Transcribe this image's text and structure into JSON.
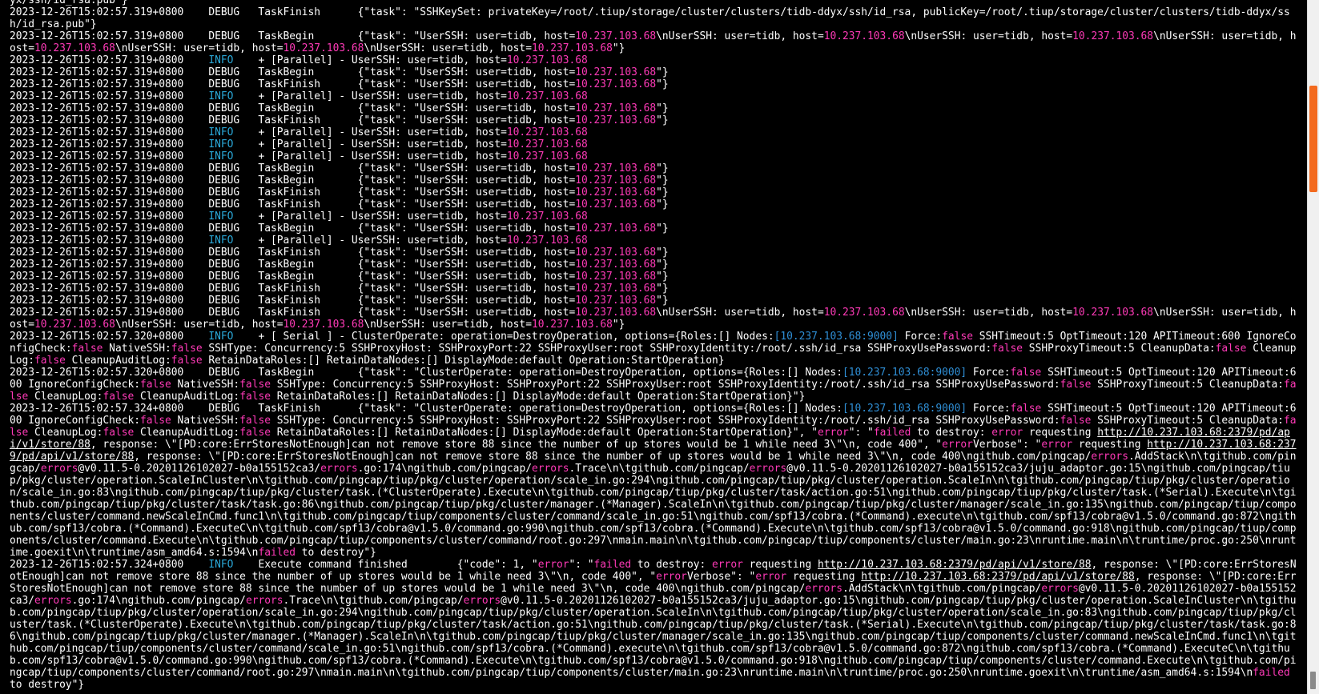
{
  "terminal": {
    "lines": [
      "yx/ssh/id_rsa.pub\"}",
      "2023-12-26T15:02:57.319+0800    DEBUG   TaskFinish      {\"task\": \"SSHKeySet: privateKey=/root/.tiup/storage/cluster/clusters/tidb-ddyx/ssh/id_rsa, publicKey=/root/.tiup/storage/cluster/clusters/tidb-ddyx/ssh/id_rsa.pub\"}",
      "2023-12-26T15:02:57.319+0800    DEBUG   TaskBegin       {\"task\": \"UserSSH: user=tidb, host=10.237.103.68\\nUserSSH: user=tidb, host=10.237.103.68\\nUserSSH: user=tidb, host=10.237.103.68\\nUserSSH: user=tidb, host=10.237.103.68\\nUserSSH: user=tidb, host=10.237.103.68\\nUserSSH: user=tidb, host=10.237.103.68\"}",
      "2023-12-26T15:02:57.319+0800    INFO    + [Parallel] - UserSSH: user=tidb, host=10.237.103.68",
      "2023-12-26T15:02:57.319+0800    DEBUG   TaskBegin       {\"task\": \"UserSSH: user=tidb, host=10.237.103.68\"}",
      "2023-12-26T15:02:57.319+0800    DEBUG   TaskFinish      {\"task\": \"UserSSH: user=tidb, host=10.237.103.68\"}",
      "2023-12-26T15:02:57.319+0800    INFO    + [Parallel] - UserSSH: user=tidb, host=10.237.103.68",
      "2023-12-26T15:02:57.319+0800    DEBUG   TaskBegin       {\"task\": \"UserSSH: user=tidb, host=10.237.103.68\"}",
      "2023-12-26T15:02:57.319+0800    DEBUG   TaskFinish      {\"task\": \"UserSSH: user=tidb, host=10.237.103.68\"}",
      "2023-12-26T15:02:57.319+0800    INFO    + [Parallel] - UserSSH: user=tidb, host=10.237.103.68",
      "2023-12-26T15:02:57.319+0800    INFO    + [Parallel] - UserSSH: user=tidb, host=10.237.103.68",
      "2023-12-26T15:02:57.319+0800    INFO    + [Parallel] - UserSSH: user=tidb, host=10.237.103.68",
      "2023-12-26T15:02:57.319+0800    DEBUG   TaskBegin       {\"task\": \"UserSSH: user=tidb, host=10.237.103.68\"}",
      "2023-12-26T15:02:57.319+0800    DEBUG   TaskBegin       {\"task\": \"UserSSH: user=tidb, host=10.237.103.68\"}",
      "2023-12-26T15:02:57.319+0800    DEBUG   TaskFinish      {\"task\": \"UserSSH: user=tidb, host=10.237.103.68\"}",
      "2023-12-26T15:02:57.319+0800    DEBUG   TaskFinish      {\"task\": \"UserSSH: user=tidb, host=10.237.103.68\"}",
      "2023-12-26T15:02:57.319+0800    INFO    + [Parallel] - UserSSH: user=tidb, host=10.237.103.68",
      "2023-12-26T15:02:57.319+0800    DEBUG   TaskBegin       {\"task\": \"UserSSH: user=tidb, host=10.237.103.68\"}",
      "2023-12-26T15:02:57.319+0800    INFO    + [Parallel] - UserSSH: user=tidb, host=10.237.103.68",
      "2023-12-26T15:02:57.319+0800    DEBUG   TaskFinish      {\"task\": \"UserSSH: user=tidb, host=10.237.103.68\"}",
      "2023-12-26T15:02:57.319+0800    DEBUG   TaskBegin       {\"task\": \"UserSSH: user=tidb, host=10.237.103.68\"}",
      "2023-12-26T15:02:57.319+0800    DEBUG   TaskBegin       {\"task\": \"UserSSH: user=tidb, host=10.237.103.68\"}",
      "2023-12-26T15:02:57.319+0800    DEBUG   TaskFinish      {\"task\": \"UserSSH: user=tidb, host=10.237.103.68\"}",
      "2023-12-26T15:02:57.319+0800    DEBUG   TaskFinish      {\"task\": \"UserSSH: user=tidb, host=10.237.103.68\"}",
      "2023-12-26T15:02:57.319+0800    DEBUG   TaskFinish      {\"task\": \"UserSSH: user=tidb, host=10.237.103.68\\nUserSSH: user=tidb, host=10.237.103.68\\nUserSSH: user=tidb, host=10.237.103.68\\nUserSSH: user=tidb, host=10.237.103.68\\nUserSSH: user=tidb, host=10.237.103.68\\nUserSSH: user=tidb, host=10.237.103.68\"}",
      "2023-12-26T15:02:57.320+0800    INFO    + [ Serial ] - ClusterOperate: operation=DestroyOperation, options={Roles:[] Nodes:[10.237.103.68:9000] Force:false SSHTimeout:5 OptTimeout:120 APITimeout:600 IgnoreConfigCheck:false NativeSSH:false SSHType: Concurrency:5 SSHProxyHost: SSHProxyPort:22 SSHProxyUser:root SSHProxyIdentity:/root/.ssh/id_rsa SSHProxyUsePassword:false SSHProxyTimeout:5 CleanupData:false CleanupLog:false CleanupAuditLog:false RetainDataRoles:[] RetainDataNodes:[] DisplayMode:default Operation:StartOperation}",
      "2023-12-26T15:02:57.320+0800    DEBUG   TaskBegin       {\"task\": \"ClusterOperate: operation=DestroyOperation, options={Roles:[] Nodes:[10.237.103.68:9000] Force:false SSHTimeout:5 OptTimeout:120 APITimeout:600 IgnoreConfigCheck:false NativeSSH:false SSHType: Concurrency:5 SSHProxyHost: SSHProxyPort:22 SSHProxyUser:root SSHProxyIdentity:/root/.ssh/id_rsa SSHProxyUsePassword:false SSHProxyTimeout:5 CleanupData:false CleanupLog:false CleanupAuditLog:false RetainDataRoles:[] RetainDataNodes:[] DisplayMode:default Operation:StartOperation}\"}",
      "2023-12-26T15:02:57.324+0800    DEBUG   TaskFinish      {\"task\": \"ClusterOperate: operation=DestroyOperation, options={Roles:[] Nodes:[10.237.103.68:9000] Force:false SSHTimeout:5 OptTimeout:120 APITimeout:600 IgnoreConfigCheck:false NativeSSH:false SSHType: Concurrency:5 SSHProxyHost: SSHProxyPort:22 SSHProxyUser:root SSHProxyIdentity:/root/.ssh/id_rsa SSHProxyUsePassword:false SSHProxyTimeout:5 CleanupData:false CleanupLog:false CleanupAuditLog:false RetainDataRoles:[] RetainDataNodes:[] DisplayMode:default Operation:StartOperation}\", \"error\": \"failed to destroy: error requesting http://10.237.103.68:2379/pd/api/v1/store/88, response: \\\"[PD:core:ErrStoresNotEnough]can not remove store 88 since the number of up stores would be 1 while need 3\\\"\\n, code 400\", \"errorVerbose\": \"error requesting http://10.237.103.68:2379/pd/api/v1/store/88, response: \\\"[PD:core:ErrStoresNotEnough]can not remove store 88 since the number of up stores would be 1 while need 3\\\"\\n, code 400\\ngithub.com/pingcap/errors.AddStack\\n\\tgithub.com/pingcap/errors@v0.11.5-0.20201126102027-b0a155152ca3/errors.go:174\\ngithub.com/pingcap/errors.Trace\\n\\tgithub.com/pingcap/errors@v0.11.5-0.20201126102027-b0a155152ca3/juju_adaptor.go:15\\ngithub.com/pingcap/tiup/pkg/cluster/operation.ScaleInCluster\\n\\tgithub.com/pingcap/tiup/pkg/cluster/operation/scale_in.go:294\\ngithub.com/pingcap/tiup/pkg/cluster/operation.ScaleIn\\n\\tgithub.com/pingcap/tiup/pkg/cluster/operation/scale_in.go:83\\ngithub.com/pingcap/tiup/pkg/cluster/task.(*ClusterOperate).Execute\\n\\tgithub.com/pingcap/tiup/pkg/cluster/task/action.go:51\\ngithub.com/pingcap/tiup/pkg/cluster/task.(*Serial).Execute\\n\\tgithub.com/pingcap/tiup/pkg/cluster/task/task.go:86\\ngithub.com/pingcap/tiup/pkg/cluster/manager.(*Manager).ScaleIn\\n\\tgithub.com/pingcap/tiup/pkg/cluster/manager/scale_in.go:135\\ngithub.com/pingcap/tiup/components/cluster/command.newScaleInCmd.func1\\n\\tgithub.com/pingcap/tiup/components/cluster/command/scale_in.go:51\\ngithub.com/spf13/cobra.(*Command).execute\\n\\tgithub.com/spf13/cobra@v1.5.0/command.go:872\\ngithub.com/spf13/cobra.(*Command).ExecuteC\\n\\tgithub.com/spf13/cobra@v1.5.0/command.go:990\\ngithub.com/spf13/cobra.(*Command).Execute\\n\\tgithub.com/spf13/cobra@v1.5.0/command.go:918\\ngithub.com/pingcap/tiup/components/cluster/command.Execute\\n\\tgithub.com/pingcap/tiup/components/cluster/command/root.go:297\\nmain.main\\n\\tgithub.com/pingcap/tiup/components/cluster/main.go:23\\nruntime.main\\n\\truntime/proc.go:250\\nruntime.goexit\\n\\truntime/asm_amd64.s:1594\\nfailed to destroy\"}",
      "2023-12-26T15:02:57.324+0800    INFO    Execute command finished        {\"code\": 1, \"error\": \"failed to destroy: error requesting http://10.237.103.68:2379/pd/api/v1/store/88, response: \\\"[PD:core:ErrStoresNotEnough]can not remove store 88 since the number of up stores would be 1 while need 3\\\"\\n, code 400\", \"errorVerbose\": \"error requesting http://10.237.103.68:2379/pd/api/v1/store/88, response: \\\"[PD:core:ErrStoresNotEnough]can not remove store 88 since the number of up stores would be 1 while need 3\\\"\\n, code 400\\ngithub.com/pingcap/errors.AddStack\\n\\tgithub.com/pingcap/errors@v0.11.5-0.20201126102027-b0a155152ca3/errors.go:174\\ngithub.com/pingcap/errors.Trace\\n\\tgithub.com/pingcap/errors@v0.11.5-0.20201126102027-b0a155152ca3/juju_adaptor.go:15\\ngithub.com/pingcap/tiup/pkg/cluster/operation.ScaleInCluster\\n\\tgithub.com/pingcap/tiup/pkg/cluster/operation/scale_in.go:294\\ngithub.com/pingcap/tiup/pkg/cluster/operation.ScaleIn\\n\\tgithub.com/pingcap/tiup/pkg/cluster/operation/scale_in.go:83\\ngithub.com/pingcap/tiup/pkg/cluster/task.(*ClusterOperate).Execute\\n\\tgithub.com/pingcap/tiup/pkg/cluster/task/action.go:51\\ngithub.com/pingcap/tiup/pkg/cluster/task.(*Serial).Execute\\n\\tgithub.com/pingcap/tiup/pkg/cluster/task/task.go:86\\ngithub.com/pingcap/tiup/pkg/cluster/manager.(*Manager).ScaleIn\\n\\tgithub.com/pingcap/tiup/pkg/cluster/manager/scale_in.go:135\\ngithub.com/pingcap/tiup/components/cluster/command.newScaleInCmd.func1\\n\\tgithub.com/pingcap/tiup/components/cluster/command/scale_in.go:51\\ngithub.com/spf13/cobra.(*Command).execute\\n\\tgithub.com/spf13/cobra@v1.5.0/command.go:872\\ngithub.com/spf13/cobra.(*Command).ExecuteC\\n\\tgithub.com/spf13/cobra@v1.5.0/command.go:990\\ngithub.com/spf13/cobra.(*Command).Execute\\n\\tgithub.com/spf13/cobra@v1.5.0/command.go:918\\ngithub.com/pingcap/tiup/components/cluster/command.Execute\\n\\tgithub.com/pingcap/tiup/components/cluster/command/root.go:297\\nmain.main\\n\\tgithub.com/pingcap/tiup/components/cluster/main.go:23\\nruntime.main\\n\\truntime/proc.go:250\\nruntime.goexit\\n\\truntime/asm_amd64.s:1594\\nfailed to destroy\"}"
    ]
  },
  "colors": {
    "background": "#000000",
    "text": "#ffffff",
    "ip_highlight": "#ff3ab8",
    "node_highlight": "#2f8fd6",
    "info_level": "#2aa8d8",
    "scrollbar_thumb": "#f36a1e"
  }
}
